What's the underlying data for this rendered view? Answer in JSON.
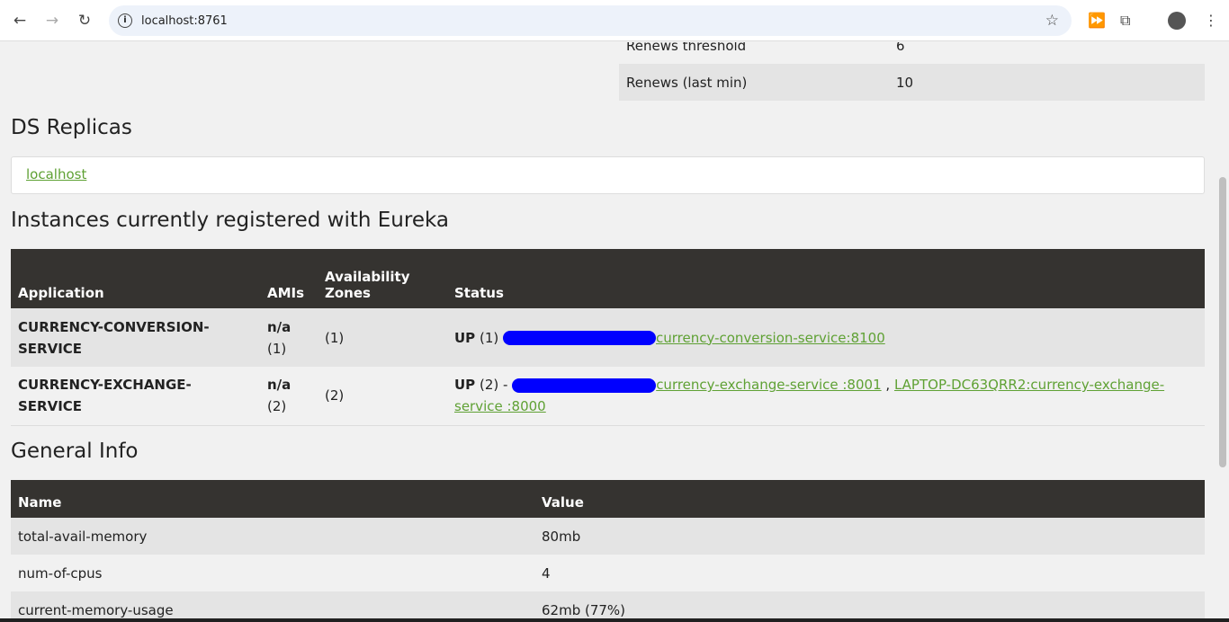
{
  "browser": {
    "url": "localhost:8761",
    "icons": [
      "back-icon",
      "forward-icon",
      "reload-icon",
      "info-icon",
      "star-icon",
      "extension-icon",
      "puzzle-icon",
      "avatar",
      "menu-icon"
    ]
  },
  "renews": [
    {
      "label": "Renews threshold",
      "value": "6"
    },
    {
      "label": "Renews (last min)",
      "value": "10"
    }
  ],
  "replicas": {
    "title": "DS Replicas",
    "link": "localhost"
  },
  "instances": {
    "title": "Instances currently registered with Eureka",
    "headers": [
      "Application",
      "AMIs",
      "Availability Zones",
      "Status"
    ],
    "rows": [
      {
        "app": "CURRENCY-CONVERSION-SERVICE",
        "ami": "n/a",
        "ami_count": "(1)",
        "zones": "(1)",
        "status": "UP",
        "status_count": "(1)",
        "links": [
          "currency-conversion-service:8100"
        ]
      },
      {
        "app": "CURRENCY-EXCHANGE-SERVICE",
        "ami": "n/a",
        "ami_count": "(2)",
        "zones": "(2)",
        "status": "UP",
        "status_count": "(2) -",
        "links": [
          "currency-exchange-service :8001",
          "LAPTOP-DC63QRR2:currency-exchange-service :8000"
        ],
        "sep": ","
      }
    ]
  },
  "general": {
    "title": "General Info",
    "headers": [
      "Name",
      "Value"
    ],
    "rows": [
      {
        "name": "total-avail-memory",
        "value": "80mb"
      },
      {
        "name": "num-of-cpus",
        "value": "4"
      },
      {
        "name": "current-memory-usage",
        "value": "62mb (77%)"
      }
    ]
  }
}
